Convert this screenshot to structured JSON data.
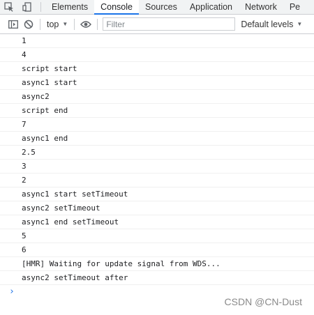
{
  "tabs": [
    "Elements",
    "Console",
    "Sources",
    "Application",
    "Network",
    "Pe"
  ],
  "active_tab": "Console",
  "toolbar": {
    "context": "top",
    "filter_placeholder": "Filter",
    "levels": "Default levels"
  },
  "logs": [
    "1",
    "4",
    "script start",
    "async1 start",
    "async2",
    "script end",
    "7",
    "async1 end",
    "2.5",
    "3",
    "2",
    "async1 start setTimeout",
    "async2 setTimeout",
    "async1 end setTimeout",
    "5",
    "6",
    "[HMR] Waiting for update signal from WDS...",
    "async2 setTimeout after"
  ],
  "prompt": "›",
  "watermark": "CSDN @CN-Dust",
  "colors": {
    "accent": "#1a73e8",
    "border": "#cbcdd1",
    "tabbar_bg": "#f1f3f4"
  }
}
